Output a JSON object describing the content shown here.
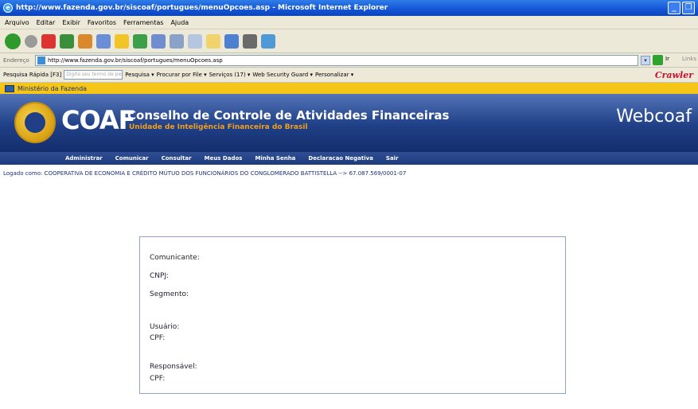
{
  "window": {
    "title": "http://www.fazenda.gov.br/siscoaf/portugues/menuOpcoes.asp - Microsoft Internet Explorer"
  },
  "menu": [
    "Arquivo",
    "Editar",
    "Exibir",
    "Favoritos",
    "Ferramentas",
    "Ajuda"
  ],
  "address": {
    "label": "Endereço",
    "url": "http://www.fazenda.gov.br/siscoaf/portugues/menuOpcoes.asp",
    "go": "Ir",
    "links": "Links"
  },
  "google": {
    "quick": "Pesquisa Rápida [F3]",
    "placeholder": "Digite seu termo de pesquisa...",
    "search": "Pesquisa ▾",
    "procurar": "Procurar por File ▾",
    "servicos": "Serviços (17) ▾",
    "wsg": "Web Security Guard ▾",
    "personalizar": "Personalizar ▾",
    "brand": "Crawler"
  },
  "gov": {
    "label": "Ministério da Fazenda"
  },
  "header": {
    "logo": "COAF",
    "title": "Conselho de Controle de Atividades Financeiras",
    "subtitle": "Unidade de Inteligência Financeira do Brasil",
    "app": "Webcoaf"
  },
  "nav": [
    "Administrar",
    "Comunicar",
    "Consultar",
    "Meus Dados",
    "Minha Senha",
    "Declaracao Negativa",
    "Sair"
  ],
  "logged": "Logado como: COOPERATIVA DE ECONOMIA E CRÉDITO MÚTUO DOS FUNCIONÁRIOS DO CONGLOMERADO BATTISTELLA --> 67.087.569/0001-07",
  "fields": {
    "comunicante": "Comunicante:",
    "cnpj": "CNPJ:",
    "segmento": "Segmento:",
    "usuario": "Usuário:",
    "cpf1": "CPF:",
    "responsavel": "Responsável:",
    "cpf2": "CPF:"
  }
}
